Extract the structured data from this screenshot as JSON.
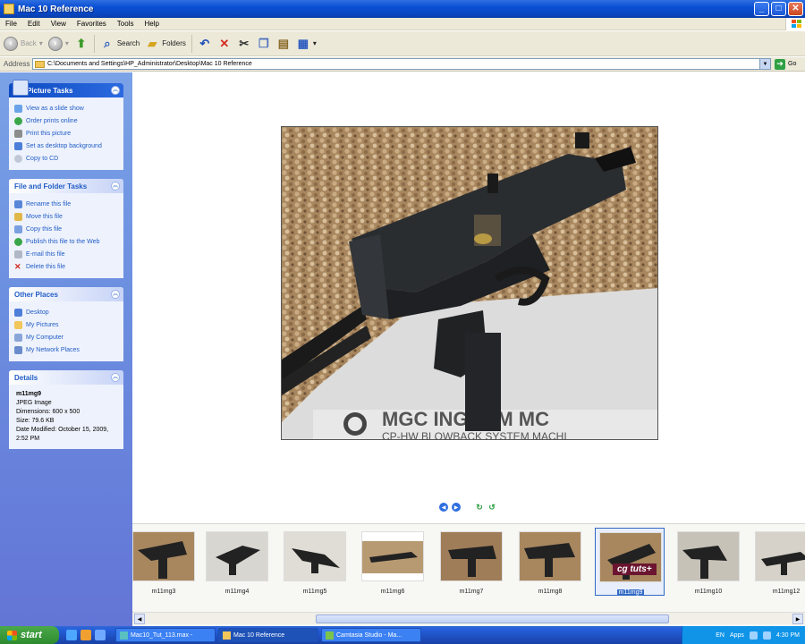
{
  "window": {
    "title": "Mac 10 Reference"
  },
  "menu": [
    "File",
    "Edit",
    "View",
    "Favorites",
    "Tools",
    "Help"
  ],
  "toolbar": {
    "back": "Back",
    "search": "Search",
    "folders": "Folders"
  },
  "address": {
    "label": "Address",
    "path": "C:\\Documents and Settings\\HP_Administrator\\Desktop\\Mac 10 Reference",
    "go": "Go"
  },
  "sidebar": {
    "picture_tasks": {
      "title": "Picture Tasks",
      "items": [
        "View as a slide show",
        "Order prints online",
        "Print this picture",
        "Set as desktop background",
        "Copy to CD"
      ]
    },
    "file_tasks": {
      "title": "File and Folder Tasks",
      "items": [
        "Rename this file",
        "Move this file",
        "Copy this file",
        "Publish this file to the Web",
        "E-mail this file",
        "Delete this file"
      ]
    },
    "other_places": {
      "title": "Other Places",
      "items": [
        "Desktop",
        "My Pictures",
        "My Computer",
        "My Network Places"
      ]
    },
    "details": {
      "title": "Details",
      "filename": "m11mg9",
      "type": "JPEG Image",
      "dimensions": "Dimensions: 600 x 500",
      "size": "Size: 79.6 KB",
      "modified": "Date Modified: October 15, 2009, 2:52 PM"
    }
  },
  "photo": {
    "caption_line1": "MGC INGRAM MC",
    "caption_line2": "CP-HW BLOWBACK SYSTEM MACHI"
  },
  "filmstrip": {
    "thumbs": [
      "m11mg3",
      "m11mg4",
      "m11mg5",
      "m11mg6",
      "m11mg7",
      "m11mg8",
      "m11mg9",
      "m11mg10",
      "m11mg12"
    ],
    "selected_index": 6,
    "watermark": "cg tuts+"
  },
  "taskbar": {
    "start": "start",
    "tasks": [
      "Mac10_Tut_113.max -",
      "Mac 10 Reference",
      "Camtasia Studio - Ma..."
    ],
    "tray_lang": "EN",
    "tray_apps": "Apps",
    "clock": "4:30 PM"
  }
}
